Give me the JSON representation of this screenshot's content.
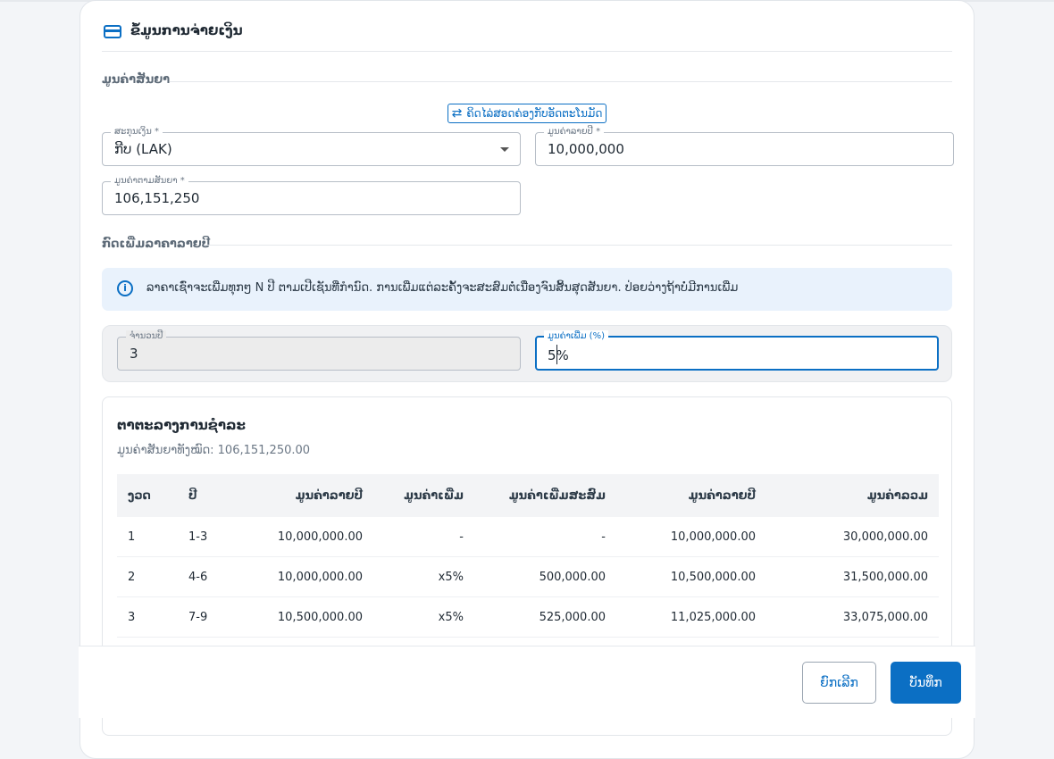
{
  "header": {
    "title": "ຂໍ້ມູນການຈ່າຍເງິນ",
    "icon": "credit-card-icon"
  },
  "contract_value_section": {
    "label": "ມູນຄ່າສັນຍາ",
    "convert_button": "ຄິດໄລ່ສອດຄ່ອງກັບອັດຕະໂນມັດ",
    "currency": {
      "label": "ສະກຸນເງິນ *",
      "value": "ກີບ (LAK)"
    },
    "annual_value": {
      "label": "ມູນຄ່າລາຍປີ *",
      "value": "10,000,000"
    },
    "contract_value": {
      "label": "ມູນຄ່າຕາມສັນຍາ *",
      "value": "106,151,250"
    }
  },
  "escalation_section": {
    "label": "ກົດເພີ່ມລາຄາລາຍປີ",
    "info_text": "ລາຄາເຊົ່າຈະເພີ່ມທຸກໆ N ປີ ຕາມເປີເຊັນທີ່ກຳນົດ. ການເພີ່ມແຕ່ລະຄັ້ງຈະສະສົມຕໍ່ເນື່ອງຈົນສິ້ນສຸດສັນຍາ. ປ່ອຍວ່າງຖ້າບໍ່ມີການເພີ່ມ",
    "years": {
      "label": "ຈຳນວນປີ",
      "value": "3"
    },
    "increase": {
      "label": "ມູນຄ່າເພີ່ມ (%)",
      "value_before_cursor": "5",
      "value_after_cursor": "%"
    }
  },
  "schedule": {
    "title": "ຕາຕະລາງການຊຳລະ",
    "subtitle": "ມູນຄ່າສັນຍາທັງໝົດ: 106,151,250.00",
    "columns": [
      "ງວດ",
      "ປີ",
      "ມູນຄ່າລາຍປີ",
      "ມູນຄ່າເພີ່ມ",
      "ມູນຄ່າເພີ່ມສະສົມ",
      "ມູນຄ່າລາຍປີ",
      "ມູນຄ່າລວມ"
    ],
    "rows": [
      [
        "1",
        "1-3",
        "10,000,000.00",
        "-",
        "-",
        "10,000,000.00",
        "30,000,000.00"
      ],
      [
        "2",
        "4-6",
        "10,000,000.00",
        "x5%",
        "500,000.00",
        "10,500,000.00",
        "31,500,000.00"
      ],
      [
        "3",
        "7-9",
        "10,500,000.00",
        "x5%",
        "525,000.00",
        "11,025,000.00",
        "33,075,000.00"
      ]
    ]
  },
  "footer": {
    "cancel": "ຍົກເລີກ",
    "save": "ບັນທຶກ"
  },
  "colors": {
    "accent": "#0b6fc4",
    "info_bg": "#e9f2fc"
  }
}
